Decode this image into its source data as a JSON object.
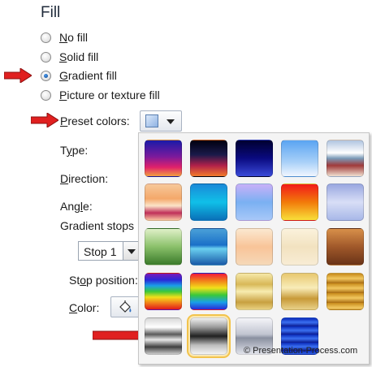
{
  "section_title": "Fill",
  "fill_options": [
    {
      "label": "No fill",
      "checked": false
    },
    {
      "label": "Solid fill",
      "checked": false
    },
    {
      "label": "Gradient fill",
      "checked": true
    },
    {
      "label": "Picture or texture fill",
      "checked": false
    }
  ],
  "fields": {
    "preset_colors": "Preset colors:",
    "type": "Type:",
    "direction": "Direction:",
    "angle": "Angle:",
    "gradient_stops": "Gradient stops",
    "stop_position": "Stop position:",
    "color": "Color:"
  },
  "gradient_stop_select": {
    "value": "Stop 1"
  },
  "arrow_color": "#e02020",
  "presets": [
    [
      "Early Sunset",
      "Late Sunset",
      "Nightfall",
      "Daybreak",
      "Horizon"
    ],
    [
      "Desert",
      "Ocean",
      "Calm Water",
      "Fire",
      "Fog"
    ],
    [
      "Moss",
      "Peacock",
      "Wheat",
      "Parchment",
      "Mahogany"
    ],
    [
      "Rainbow",
      "Rainbow II",
      "Gold",
      "Gold II",
      "Brass"
    ],
    [
      "Chrome",
      "Chrome II",
      "Silver",
      "Sapphire"
    ]
  ],
  "selected_preset": "Chrome II",
  "watermark": "© Presentation-Process.com"
}
